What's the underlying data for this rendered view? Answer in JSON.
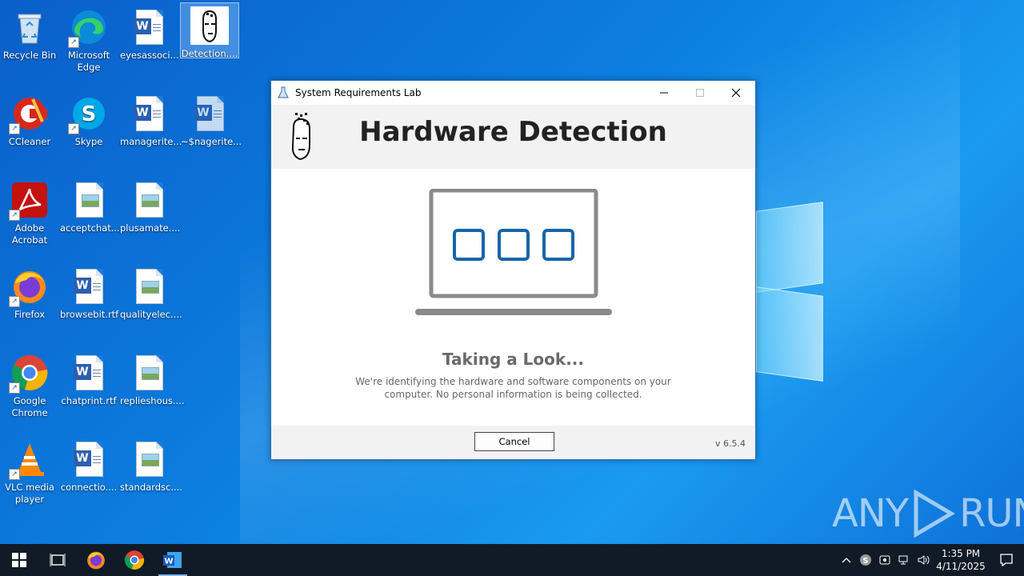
{
  "desktop": {
    "icons": [
      {
        "label": "Recycle Bin",
        "icon": "recycle-bin-icon"
      },
      {
        "label": "Microsoft Edge",
        "icon": "edge-icon"
      },
      {
        "label": "eyesassoci...",
        "icon": "word-doc-icon"
      },
      {
        "label": "Detection....",
        "icon": "detection-app-icon"
      },
      {
        "label": "CCleaner",
        "icon": "ccleaner-icon"
      },
      {
        "label": "Skype",
        "icon": "skype-icon"
      },
      {
        "label": "managerite...",
        "icon": "word-doc-icon"
      },
      {
        "label": "~$nagerite...",
        "icon": "word-doc-icon"
      },
      {
        "label": "Adobe Acrobat",
        "icon": "acrobat-icon"
      },
      {
        "label": "acceptchat....",
        "icon": "image-file-icon"
      },
      {
        "label": "plusamate....",
        "icon": "image-file-icon"
      },
      {
        "label": "Firefox",
        "icon": "firefox-icon"
      },
      {
        "label": "browsebit.rtf",
        "icon": "word-doc-icon"
      },
      {
        "label": "qualityelec....",
        "icon": "image-file-icon"
      },
      {
        "label": "Google Chrome",
        "icon": "chrome-icon"
      },
      {
        "label": "chatprint.rtf",
        "icon": "word-doc-icon"
      },
      {
        "label": "replieshous....",
        "icon": "image-file-icon"
      },
      {
        "label": "VLC media player",
        "icon": "vlc-icon"
      },
      {
        "label": "connectio....",
        "icon": "word-doc-icon"
      },
      {
        "label": "standardsc....",
        "icon": "image-file-icon"
      }
    ]
  },
  "dialog": {
    "title": "System Requirements Lab",
    "heading": "Hardware Detection",
    "status_title": "Taking a Look...",
    "status_desc": "We're identifying the hardware and software components on your computer. No personal information is being collected.",
    "cancel_label": "Cancel",
    "version": "v 6.5.4"
  },
  "watermark": {
    "left": "ANY",
    "right": "RUN"
  },
  "taskbar": {
    "time": "1:35 PM",
    "date": "4/11/2025"
  },
  "colors": {
    "accent": "#1565a8",
    "laptop_gray": "#8a8a8a",
    "desktop_blue": "#0c7fe0"
  }
}
